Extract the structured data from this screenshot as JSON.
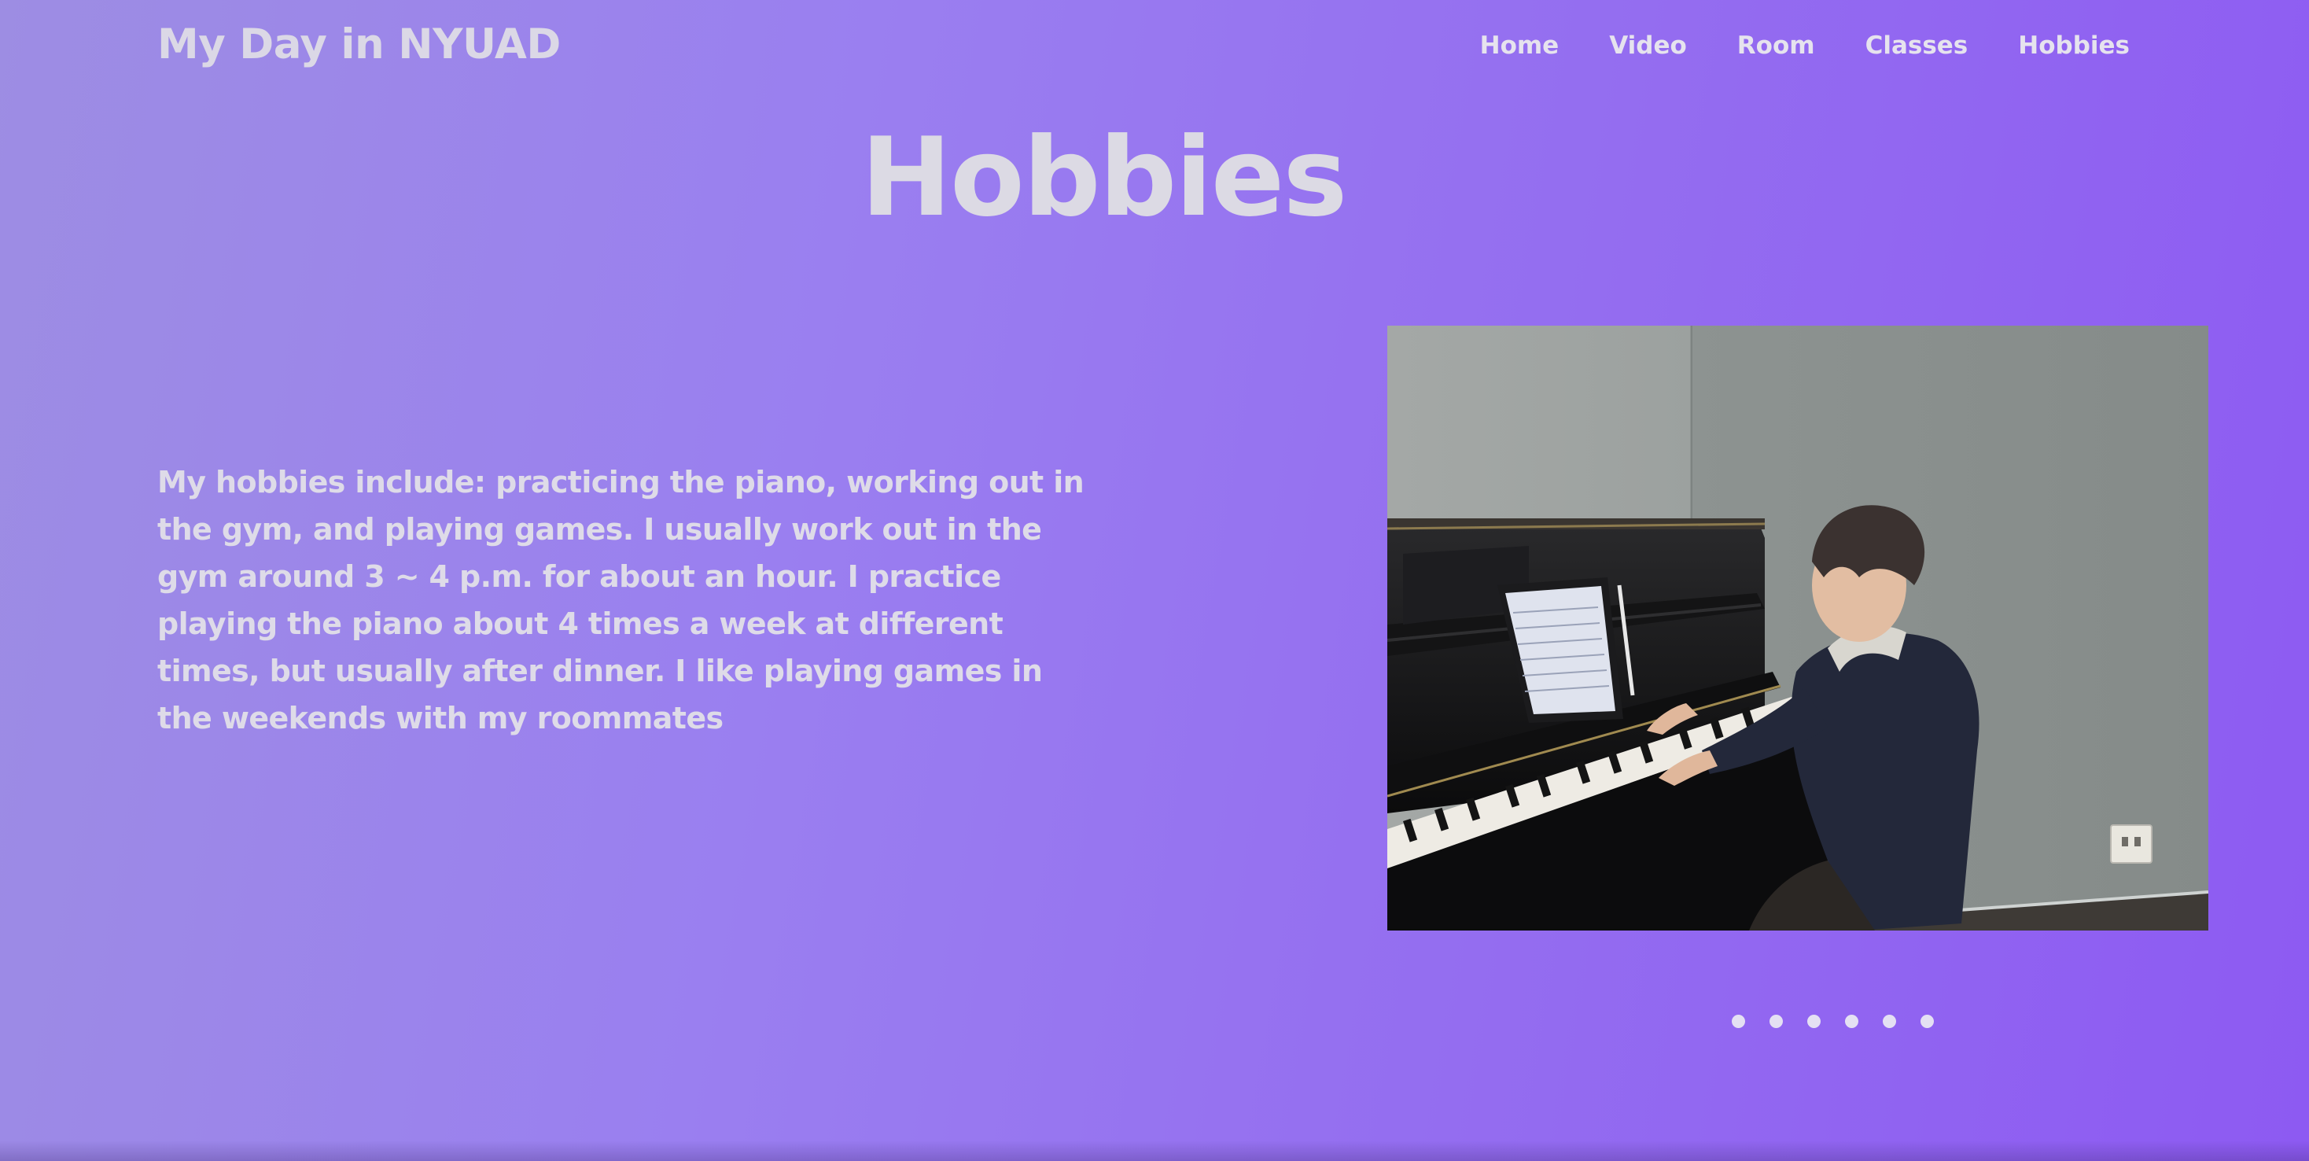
{
  "header": {
    "site_title": "My Day in NYUAD",
    "nav": [
      {
        "label": "Home"
      },
      {
        "label": "Video"
      },
      {
        "label": "Room"
      },
      {
        "label": "Classes"
      },
      {
        "label": "Hobbies"
      }
    ]
  },
  "main": {
    "title": "Hobbies",
    "description": "My hobbies include: practicing the piano, working out in the gym, and playing games. I usually work out in the gym around 3 ~ 4 p.m. for about an hour. I practice playing the piano about 4 times a week at different times, but usually after dinner. I like playing games in the weekends with my roommates",
    "slider": {
      "current_slide": 1,
      "slide_count": 6,
      "photo_subject": "person playing an upright piano in a practice room"
    }
  },
  "colors": {
    "background_start": "#9d8de3",
    "background_end": "#8d5af2",
    "text": "#dedbe8",
    "dot": "#e4e0f3"
  }
}
